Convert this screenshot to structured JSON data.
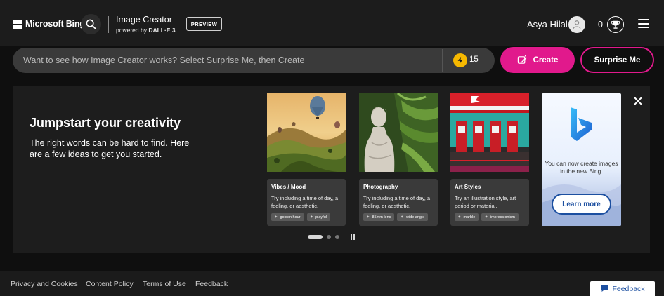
{
  "header": {
    "brand": "Microsoft Bing",
    "product_title": "Image Creator",
    "product_sub_prefix": "powered by ",
    "product_sub_model": "DALL·E 3",
    "preview_badge": "PREVIEW",
    "user_name": "Asya Hilal",
    "rewards_count": "0"
  },
  "prompt": {
    "placeholder": "Want to see how Image Creator works? Select Surprise Me, then Create",
    "boosts": "15",
    "create_label": "Create",
    "surprise_label": "Surprise Me"
  },
  "jumpstart": {
    "title": "Jumpstart your creativity",
    "description": "The right words can be hard to find. Here are a few ideas to get you started.",
    "cards": [
      {
        "title": "Vibes / Mood",
        "text": "Try including a time of day, a feeling, or aesthetic.",
        "chips": [
          "golden hour",
          "playful"
        ]
      },
      {
        "title": "Photography",
        "text": "Try including a time of day, a feeling, or aesthetic.",
        "chips": [
          "85mm lens",
          "wide angle"
        ]
      },
      {
        "title": "Art Styles",
        "text": "Try an illustration style, art period or material.",
        "chips": [
          "marble",
          "impressionism"
        ]
      }
    ],
    "promo": {
      "text": "You can now create images in the new Bing.",
      "button": "Learn more"
    },
    "carousel": {
      "pages": 3,
      "active_page": 1
    }
  },
  "footer": {
    "links": [
      "Privacy and Cookies",
      "Content Policy",
      "Terms of Use",
      "Feedback"
    ],
    "feedback_button": "Feedback"
  },
  "colors": {
    "accent": "#e1198c",
    "page_bg": "#0f0f0f",
    "header_bg": "#1c1c1c",
    "panel_bg": "#1d1d1d",
    "link_blue": "#1c4fa0"
  }
}
